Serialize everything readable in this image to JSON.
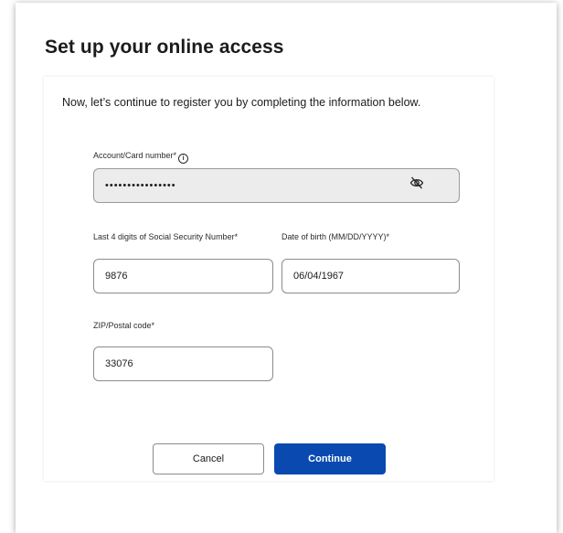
{
  "page": {
    "title": "Set up your online access",
    "intro": "Now, let’s continue to register you by completing the information below."
  },
  "form": {
    "account": {
      "label": "Account/Card number*",
      "value": "••••••••••••••••",
      "info_icon": "info-circle-icon",
      "visibility_icon": "eye-slash-icon"
    },
    "ssn_last4": {
      "label": "Last 4 digits of Social Security Number*",
      "value": "9876"
    },
    "dob": {
      "label": "Date of birth (MM/DD/YYYY)*",
      "value": "06/04/1967"
    },
    "zip": {
      "label": "ZIP/Postal code*",
      "value": "33076"
    }
  },
  "actions": {
    "cancel_label": "Cancel",
    "continue_label": "Continue"
  },
  "colors": {
    "primary": "#0a4ab0",
    "disabled_field": "#ececec",
    "border": "#8c8c8c",
    "text": "#1b1b1b"
  }
}
